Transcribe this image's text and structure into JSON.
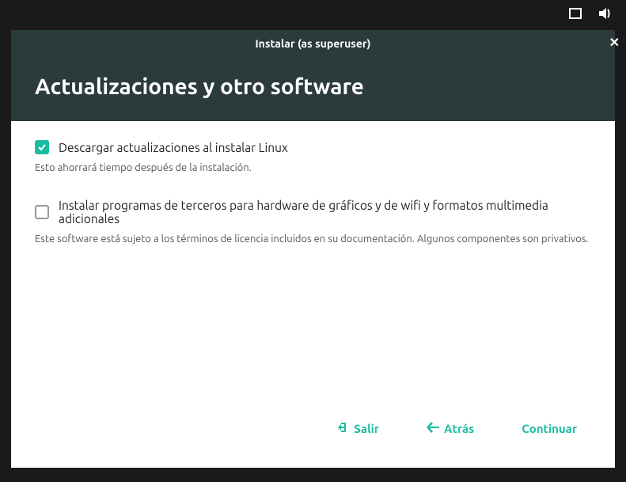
{
  "titlebar": {
    "title": "Instalar (as superuser)"
  },
  "heading": "Actualizaciones y otro software",
  "options": [
    {
      "label": "Descargar actualizaciones al instalar Linux",
      "desc": "Esto ahorrará tiempo después de la instalación.",
      "checked": true
    },
    {
      "label": "Instalar programas de terceros para hardware de gráficos y de wifi y formatos multimedia adicionales",
      "desc": "Este software está sujeto a los términos de licencia incluidos en su documentación. Algunos componentes son privativos.",
      "checked": false
    }
  ],
  "footer": {
    "quit": "Salir",
    "back": "Atrás",
    "continue": "Continuar"
  },
  "colors": {
    "accent": "#1bbba2",
    "header_bg": "#2b3b3b"
  }
}
